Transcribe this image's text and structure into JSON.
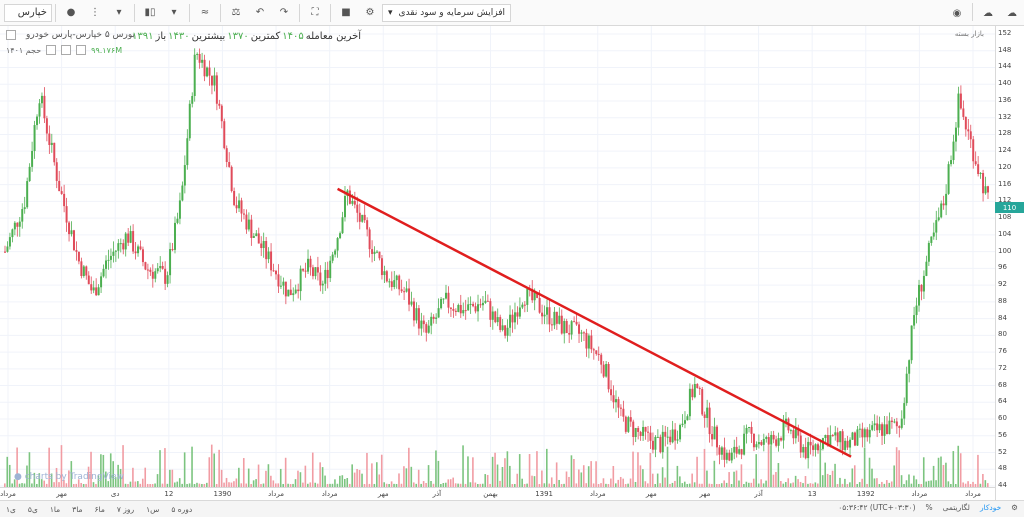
{
  "toolbar": {
    "symbol": "خپارس",
    "indicator_dropdown": "افزایش سرمایه و سود نقدی",
    "icons": [
      "symbol-search-icon",
      "interval-icon",
      "dropdown-icon",
      "candle-type-icon",
      "dropdown-icon",
      "indicators-icon",
      "compare-icon",
      "undo-icon",
      "redo-icon",
      "fullscreen-icon",
      "save-icon",
      "settings-icon",
      "dropdown-icon",
      "camera-icon",
      "cloud-download-icon",
      "cloud-upload-icon"
    ]
  },
  "legend": {
    "instrument": "بورس ۵ خپارس-پارس خودرو",
    "open_label": "باز",
    "open": "۱۳۹۱",
    "high_label": "بیشترین",
    "high": "۱۴۳۰",
    "low_label": "کمترین",
    "low": "۱۳۷۰",
    "close_label": "آخرین معامله",
    "close": "۱۴۰۵",
    "volume_label": "حجم ۱۴۰۱",
    "volume_value": "۹۹.۱۷۶M"
  },
  "market_label": "بازار بسته",
  "last_price": "110",
  "chart_data": {
    "type": "candlestick",
    "title": "",
    "xlabel": "",
    "ylabel": "",
    "ylim": [
      44,
      152
    ],
    "y_ticks": [
      44,
      48,
      52,
      56,
      60,
      64,
      68,
      72,
      76,
      80,
      84,
      88,
      92,
      96,
      100,
      104,
      108,
      112,
      116,
      120,
      124,
      128,
      132,
      136,
      140,
      144,
      148,
      152
    ],
    "x_tick_labels": [
      "مرداد",
      "مهر",
      "دی",
      "12",
      "1390",
      "مرداد",
      "مرداد",
      "مهر",
      "آذر",
      "بهمن",
      "1391",
      "مرداد",
      "مهر",
      "مهر",
      "آذر",
      "13",
      "1392",
      "مرداد",
      "مرداد"
    ],
    "price_path": [
      {
        "t": 0,
        "price": 100
      },
      {
        "t": 4,
        "price": 112
      },
      {
        "t": 7,
        "price": 138
      },
      {
        "t": 11,
        "price": 116
      },
      {
        "t": 15,
        "price": 98
      },
      {
        "t": 18,
        "price": 90
      },
      {
        "t": 21,
        "price": 98
      },
      {
        "t": 25,
        "price": 104
      },
      {
        "t": 29,
        "price": 96
      },
      {
        "t": 33,
        "price": 94
      },
      {
        "t": 36,
        "price": 112
      },
      {
        "t": 39,
        "price": 148
      },
      {
        "t": 43,
        "price": 140
      },
      {
        "t": 47,
        "price": 112
      },
      {
        "t": 51,
        "price": 104
      },
      {
        "t": 55,
        "price": 96
      },
      {
        "t": 58,
        "price": 90
      },
      {
        "t": 62,
        "price": 96
      },
      {
        "t": 65,
        "price": 92
      },
      {
        "t": 68,
        "price": 104
      },
      {
        "t": 70,
        "price": 114
      },
      {
        "t": 74,
        "price": 104
      },
      {
        "t": 78,
        "price": 94
      },
      {
        "t": 82,
        "price": 90
      },
      {
        "t": 86,
        "price": 80
      },
      {
        "t": 90,
        "price": 88
      },
      {
        "t": 94,
        "price": 86
      },
      {
        "t": 98,
        "price": 88
      },
      {
        "t": 102,
        "price": 80
      },
      {
        "t": 106,
        "price": 90
      },
      {
        "t": 110,
        "price": 86
      },
      {
        "t": 114,
        "price": 82
      },
      {
        "t": 118,
        "price": 80
      },
      {
        "t": 122,
        "price": 74
      },
      {
        "t": 126,
        "price": 60
      },
      {
        "t": 130,
        "price": 56
      },
      {
        "t": 134,
        "price": 54
      },
      {
        "t": 138,
        "price": 58
      },
      {
        "t": 141,
        "price": 68
      },
      {
        "t": 145,
        "price": 56
      },
      {
        "t": 148,
        "price": 50
      },
      {
        "t": 152,
        "price": 56
      },
      {
        "t": 156,
        "price": 54
      },
      {
        "t": 160,
        "price": 58
      },
      {
        "t": 164,
        "price": 52
      },
      {
        "t": 168,
        "price": 56
      },
      {
        "t": 172,
        "price": 54
      },
      {
        "t": 176,
        "price": 56
      },
      {
        "t": 180,
        "price": 58
      },
      {
        "t": 183,
        "price": 58
      },
      {
        "t": 186,
        "price": 86
      },
      {
        "t": 189,
        "price": 100
      },
      {
        "t": 192,
        "price": 112
      },
      {
        "t": 195,
        "price": 136
      },
      {
        "t": 198,
        "price": 124
      },
      {
        "t": 201,
        "price": 112
      }
    ],
    "trendline": {
      "start": {
        "t": 68,
        "price": 115
      },
      "end": {
        "t": 173,
        "price": 51
      },
      "color": "#e01e1e"
    },
    "bull_color": "#4caf50",
    "bear_color": "#e04b5a",
    "volume_color_up": "#7cc47f",
    "volume_color_down": "#f19ca3"
  },
  "time_ranges": [
    "۱ی",
    "۵ی",
    "۱ما",
    "۳ما",
    "۶ما",
    "روز ۷",
    "۱س",
    "دوره ۵"
  ],
  "bottom_right": {
    "timestamp": "۰۵:۳۶:۴۲ (UTC+۰۳:۳۰)",
    "percent": "%",
    "log": "لگاریتمی",
    "auto": "خودکار"
  }
}
